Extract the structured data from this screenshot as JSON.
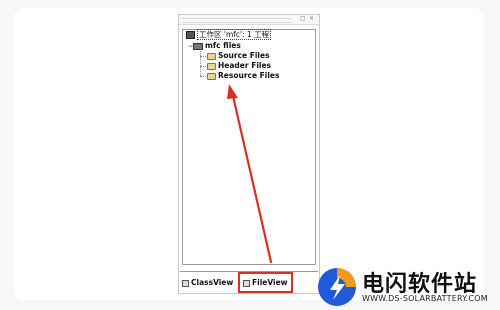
{
  "tree": {
    "workspace_label": "工作区 'mfc': 1 工程",
    "project_label": "mfc files",
    "folders": [
      "Source Files",
      "Header Files",
      "Resource Files"
    ],
    "expander_symbol": "−"
  },
  "tabs": {
    "classview": "ClassView",
    "fileview": "FileView"
  },
  "pane_buttons": [
    "▢",
    "×"
  ],
  "watermark": {
    "title": "电闪软件站",
    "url": "WWW.DS-SOLARBATTERY.COM"
  },
  "colors": {
    "highlight_red": "#d93025",
    "logo_blue": "#1f5bd6",
    "logo_orange": "#f29a1b"
  }
}
